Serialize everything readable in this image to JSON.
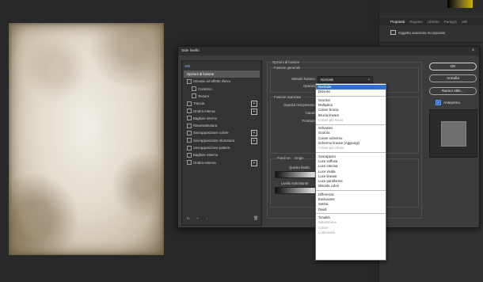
{
  "right_panel": {
    "tabs": [
      "Proprietà",
      "Regolaz",
      "Librerie",
      "Paragra",
      "Stili"
    ],
    "active_tab": "Proprietà",
    "smart_object_label": "Oggetto avanzato incorporato"
  },
  "dialog": {
    "title": "Stile livello",
    "styles_header": "Stili",
    "styles": [
      {
        "label": "Opzioni di fusione",
        "selected": true,
        "checkbox": false,
        "plus": false
      },
      {
        "label": "Smusso ed effetto rilievo",
        "checkbox": true,
        "plus": false
      },
      {
        "label": "Contorno",
        "checkbox": true,
        "plus": false,
        "indent": true
      },
      {
        "label": "Texture",
        "checkbox": true,
        "plus": false,
        "indent": true
      },
      {
        "label": "Traccia",
        "checkbox": true,
        "plus": true
      },
      {
        "label": "Ombra interna",
        "checkbox": true,
        "plus": true
      },
      {
        "label": "Bagliore interno",
        "checkbox": true,
        "plus": false
      },
      {
        "label": "Raso/satinatura",
        "checkbox": true,
        "plus": false
      },
      {
        "label": "Sovrapposizione colore",
        "checkbox": true,
        "plus": true
      },
      {
        "label": "Sovrapposizione sfumatura",
        "checkbox": true,
        "plus": true
      },
      {
        "label": "Sovrapposizione pattern",
        "checkbox": true,
        "plus": false
      },
      {
        "label": "Bagliore esterno",
        "checkbox": true,
        "plus": false
      },
      {
        "label": "Ombra esterna",
        "checkbox": true,
        "plus": true
      }
    ],
    "footer_icons": [
      "fx",
      "+",
      "↑",
      "trash"
    ],
    "options": {
      "group_title": "Opzioni di fusione",
      "general_title": "Fusione generale",
      "blend_mode_label": "Metodo fusione:",
      "blend_mode_value": "Normale",
      "opacity_label": "Opacità:",
      "advanced_title": "Fusione avanzata",
      "fill_opacity_label": "Opacità riempimento:",
      "channels_label": "Canali:",
      "knockout_label": "Foratura:",
      "blend_if_label": "Fondi se:",
      "this_layer_label": "Questo livello:",
      "underlying_label": "Livello sottostante:",
      "blend_if_value": "Grigio"
    },
    "blend_modes": [
      {
        "label": "Normale",
        "highlighted": true
      },
      {
        "label": "Dissolvi"
      },
      {
        "sep": true
      },
      {
        "label": "Scurisci"
      },
      {
        "label": "Moltiplica"
      },
      {
        "label": "Colore brucia"
      },
      {
        "label": "Brucia lineare"
      },
      {
        "label": "Colore più scuro",
        "dim": true
      },
      {
        "sep": true
      },
      {
        "label": "Schiarisci"
      },
      {
        "label": "Scolora"
      },
      {
        "label": "Colore schermo"
      },
      {
        "label": "Schermo lineare (Aggiungi)"
      },
      {
        "label": "Colore più chiaro",
        "dim": true
      },
      {
        "sep": true
      },
      {
        "label": "Sovrapponi"
      },
      {
        "label": "Luce soffusa"
      },
      {
        "label": "Luce intensa"
      },
      {
        "label": "Luce vivida"
      },
      {
        "label": "Luce lineare"
      },
      {
        "label": "Luce puntiforme"
      },
      {
        "label": "Miscela colori"
      },
      {
        "sep": true
      },
      {
        "label": "Differenza"
      },
      {
        "label": "Esclusione"
      },
      {
        "label": "Sottrai"
      },
      {
        "label": "Dividi"
      },
      {
        "sep": true
      },
      {
        "label": "Tonalità"
      },
      {
        "label": "Saturazione",
        "dim": true
      },
      {
        "label": "Colore",
        "dim": true
      },
      {
        "label": "Luminosità",
        "dim": true
      }
    ],
    "buttons": {
      "ok": "OK",
      "cancel": "Annulla",
      "new_style": "Nuovo stile...",
      "preview": "Anteprima"
    }
  },
  "colors": {
    "highlight": "#2f6fd6",
    "dialog_bg": "#3c3c3c",
    "workspace": "#262626"
  }
}
